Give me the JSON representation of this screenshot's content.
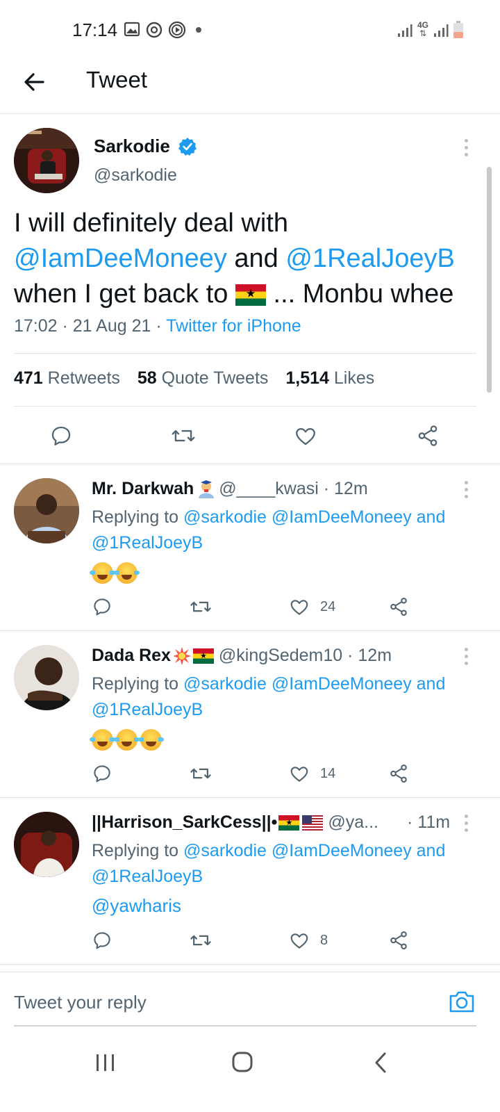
{
  "status_bar": {
    "time": "17:14",
    "network_label": "4G",
    "icons": [
      "image-icon",
      "whatsapp-icon",
      "media-icon",
      "dot-icon",
      "signal-icon",
      "network-4g-icon",
      "signal-icon",
      "battery-icon"
    ]
  },
  "header": {
    "title": "Tweet"
  },
  "main_tweet": {
    "name": "Sarkodie",
    "handle": "@sarkodie",
    "text_line1": "I will definitely deal with",
    "mention1": "@IamDeeMoneey",
    "and_word": " and ",
    "mention2": "@1RealJoeyB",
    "text_line3_start": "when I get back to ",
    "text_line3_end": " ... Monbu whee",
    "timestamp": "17:02 · 21 Aug 21 · ",
    "client": "Twitter for iPhone",
    "retweets_count": "471",
    "retweets_label": "Retweets",
    "quotes_count": "58",
    "quotes_label": "Quote Tweets",
    "likes_count": "1,514",
    "likes_label": "Likes"
  },
  "replies": [
    {
      "name": "Mr. Darkwah",
      "handle": "@____kwasi",
      "time": "· 12m",
      "replying_to": "Replying to",
      "mentions_line1": "@sarkodie @IamDeeMoneey and",
      "mentions_line2": "@1RealJoeyB",
      "likes": "24"
    },
    {
      "name": "Dada Rex",
      "handle": "@kingSedem10",
      "time": "· 12m",
      "replying_to": "Replying to",
      "mentions_line1": "@sarkodie @IamDeeMoneey and",
      "mentions_line2": "@1RealJoeyB",
      "likes": "14"
    },
    {
      "name": "||Harrison_SarkCess||•",
      "handle": "@ya...",
      "time": "· 11m",
      "replying_to": "Replying to",
      "mentions_line1": "@sarkodie @IamDeeMoneey and",
      "mentions_line2": "@1RealJoeyB",
      "body": "@yawharis",
      "likes": "8"
    }
  ],
  "compose": {
    "placeholder": "Tweet your reply"
  },
  "colors": {
    "link_blue": "#1d9bf0",
    "text": "#0f1419",
    "secondary": "#536471",
    "verified": "#1d9bf0"
  }
}
